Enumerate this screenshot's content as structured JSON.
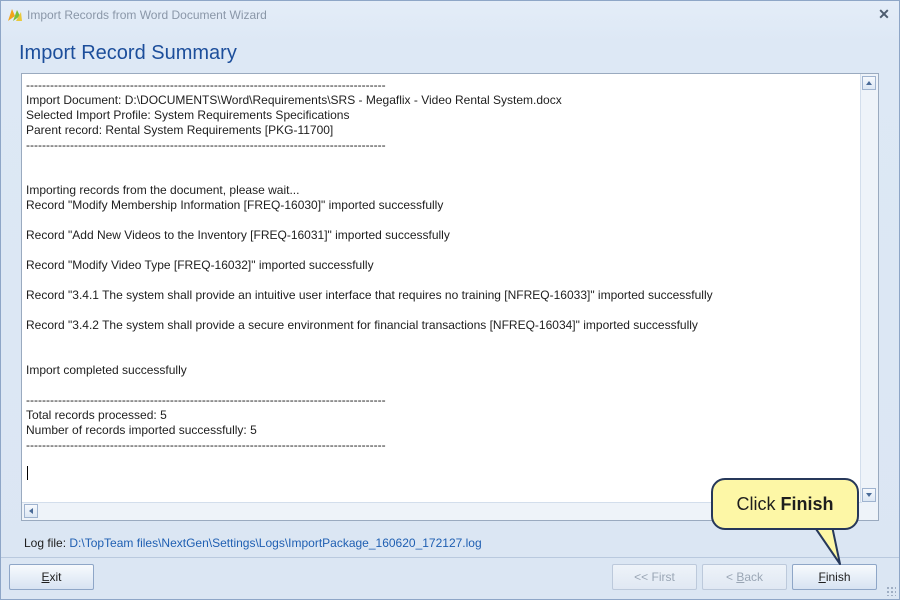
{
  "window": {
    "title": "Import Records from Word Document Wizard",
    "close_glyph": "✕",
    "icon": "app-icon"
  },
  "heading": "Import Record Summary",
  "log": {
    "lines": [
      "------------------------------------------------------------------------------------------",
      "Import Document: D:\\DOCUMENTS\\Word\\Requirements\\SRS - Megaflix - Video Rental System.docx",
      "Selected Import Profile: System Requirements Specifications",
      "Parent record: Rental System Requirements [PKG-11700]",
      "------------------------------------------------------------------------------------------",
      "",
      "",
      "Importing records from the document, please wait...",
      "Record \"Modify Membership Information [FREQ-16030]\" imported successfully",
      "",
      "Record \"Add New Videos to the Inventory [FREQ-16031]\" imported successfully",
      "",
      "Record \"Modify Video Type [FREQ-16032]\" imported successfully",
      "",
      "Record \"3.4.1 The system shall provide an intuitive user interface that requires no training [NFREQ-16033]\" imported successfully",
      "",
      "Record \"3.4.2 The system shall provide a secure environment for financial transactions [NFREQ-16034]\" imported successfully",
      "",
      "",
      "Import completed successfully",
      "",
      "------------------------------------------------------------------------------------------",
      "Total records processed: 5",
      "Number of records imported successfully: 5",
      "------------------------------------------------------------------------------------------"
    ]
  },
  "log_file": {
    "label": "Log file: ",
    "path": "D:\\TopTeam files\\NextGen\\Settings\\Logs\\ImportPackage_160620_172127.log"
  },
  "buttons": {
    "exit": "Exit",
    "first": "<< First",
    "back": "< Back",
    "finish": "Finish"
  },
  "callout": {
    "prefix": "Click ",
    "emphasis": "Finish"
  },
  "colors": {
    "heading": "#1c4e9b",
    "link": "#1f5fb2",
    "callout_fill": "#fdf7a6",
    "callout_border": "#26385a"
  }
}
